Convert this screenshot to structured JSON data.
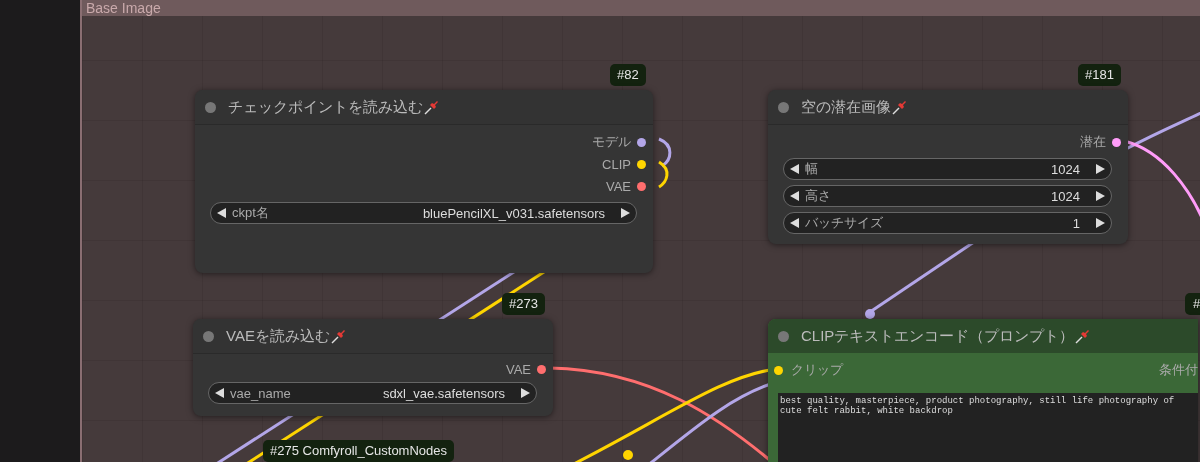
{
  "group": {
    "title": "Base Image"
  },
  "nodes": [
    {
      "kind": "basic",
      "badge": "#82",
      "title": "チェックポイントを読み込む",
      "outputs": [
        {
          "label": "モデル",
          "color": "#b3a6e8"
        },
        {
          "label": "CLIP",
          "color": "#ffd500"
        },
        {
          "label": "VAE",
          "color": "#ff6e6e"
        }
      ],
      "widgets": [
        {
          "label": "ckpt名",
          "value": "bluePencilXL_v031.safetensors"
        }
      ]
    },
    {
      "kind": "basic",
      "badge": "#181",
      "title": "空の潜在画像",
      "outputs": [
        {
          "label": "潜在",
          "color": "#ff9cf9"
        }
      ],
      "widgets": [
        {
          "label": "幅",
          "value": "1024"
        },
        {
          "label": "高さ",
          "value": "1024"
        },
        {
          "label": "バッチサイズ",
          "value": "1"
        }
      ]
    },
    {
      "kind": "basic",
      "badge": "#273",
      "title": "VAEを読み込む",
      "outputs": [
        {
          "label": "VAE",
          "color": "#ff6e6e"
        }
      ],
      "widgets": [
        {
          "label": "vae_name",
          "value": "sdxl_vae.safetensors"
        }
      ]
    },
    {
      "kind": "prompt",
      "badge": "#",
      "title": "CLIPテキストエンコード（プロンプト）",
      "inputs": [
        {
          "label": "クリップ",
          "color": "#ffd500"
        }
      ],
      "outputs": [
        {
          "label": "条件付"
        }
      ],
      "text_lines": [
        "best quality, masterpiece, product photography, still life photography of",
        "cute felt rabbit, white backdrop"
      ]
    }
  ],
  "badges": [
    {
      "text": "#275 Comfyroll_CustomNodes"
    }
  ]
}
